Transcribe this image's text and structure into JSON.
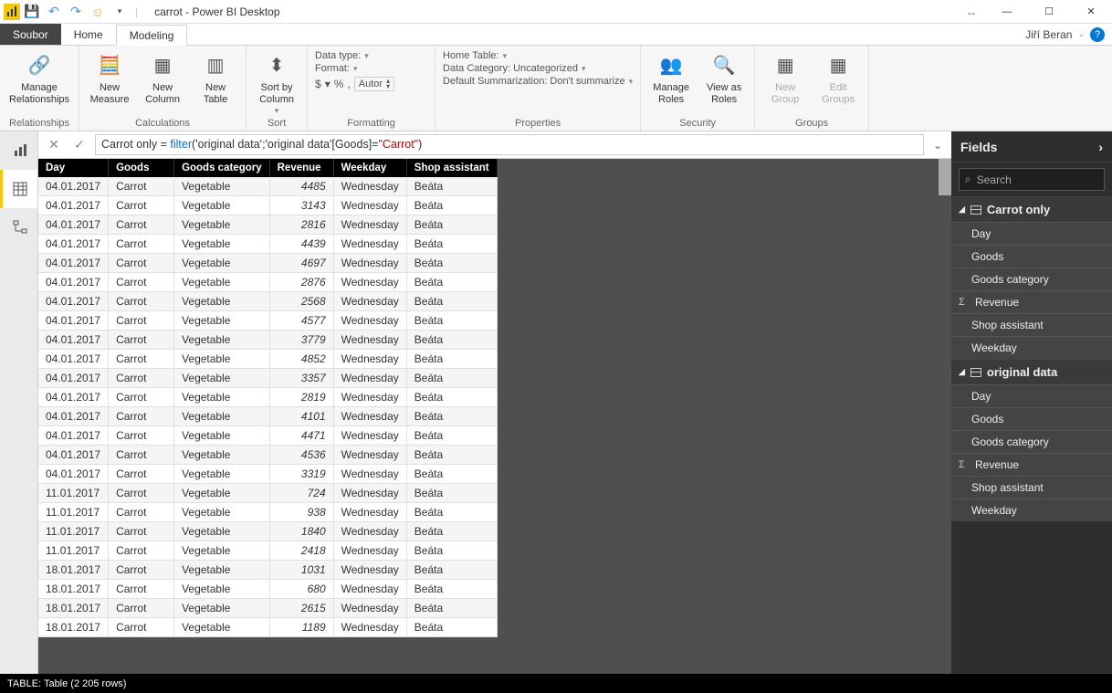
{
  "title": "carrot - Power BI Desktop",
  "user": "Jiří Beran",
  "tabs": {
    "file": "Soubor",
    "home": "Home",
    "modeling": "Modeling"
  },
  "ribbon": {
    "relationships": {
      "manage": "Manage\nRelationships",
      "group": "Relationships"
    },
    "calculations": {
      "measure": "New\nMeasure",
      "column": "New\nColumn",
      "table": "New\nTable",
      "group": "Calculations"
    },
    "sort": {
      "sortby": "Sort by\nColumn",
      "group": "Sort"
    },
    "formatting": {
      "datatype": "Data type:",
      "format": "Format:",
      "autor": "Autor",
      "group": "Formatting"
    },
    "properties": {
      "hometable": "Home Table:",
      "datacat": "Data Category: Uncategorized",
      "defsum": "Default Summarization: Don't summarize",
      "group": "Properties"
    },
    "security": {
      "manage": "Manage\nRoles",
      "viewas": "View as\nRoles",
      "group": "Security"
    },
    "groups": {
      "new": "New\nGroup",
      "edit": "Edit\nGroups",
      "group": "Groups"
    }
  },
  "formula": {
    "plain_prefix": "Carrot only = ",
    "func": "filter",
    "open": "(",
    "arg1": "'original data';'original data'[Goods]=",
    "str": "\"Carrot\"",
    "close": ")"
  },
  "columns": [
    "Day",
    "Goods",
    "Goods category",
    "Revenue",
    "Weekday",
    "Shop assistant"
  ],
  "rows": [
    [
      "04.01.2017",
      "Carrot",
      "Vegetable",
      "4485",
      "Wednesday",
      "Beáta"
    ],
    [
      "04.01.2017",
      "Carrot",
      "Vegetable",
      "3143",
      "Wednesday",
      "Beáta"
    ],
    [
      "04.01.2017",
      "Carrot",
      "Vegetable",
      "2816",
      "Wednesday",
      "Beáta"
    ],
    [
      "04.01.2017",
      "Carrot",
      "Vegetable",
      "4439",
      "Wednesday",
      "Beáta"
    ],
    [
      "04.01.2017",
      "Carrot",
      "Vegetable",
      "4697",
      "Wednesday",
      "Beáta"
    ],
    [
      "04.01.2017",
      "Carrot",
      "Vegetable",
      "2876",
      "Wednesday",
      "Beáta"
    ],
    [
      "04.01.2017",
      "Carrot",
      "Vegetable",
      "2568",
      "Wednesday",
      "Beáta"
    ],
    [
      "04.01.2017",
      "Carrot",
      "Vegetable",
      "4577",
      "Wednesday",
      "Beáta"
    ],
    [
      "04.01.2017",
      "Carrot",
      "Vegetable",
      "3779",
      "Wednesday",
      "Beáta"
    ],
    [
      "04.01.2017",
      "Carrot",
      "Vegetable",
      "4852",
      "Wednesday",
      "Beáta"
    ],
    [
      "04.01.2017",
      "Carrot",
      "Vegetable",
      "3357",
      "Wednesday",
      "Beáta"
    ],
    [
      "04.01.2017",
      "Carrot",
      "Vegetable",
      "2819",
      "Wednesday",
      "Beáta"
    ],
    [
      "04.01.2017",
      "Carrot",
      "Vegetable",
      "4101",
      "Wednesday",
      "Beáta"
    ],
    [
      "04.01.2017",
      "Carrot",
      "Vegetable",
      "4471",
      "Wednesday",
      "Beáta"
    ],
    [
      "04.01.2017",
      "Carrot",
      "Vegetable",
      "4536",
      "Wednesday",
      "Beáta"
    ],
    [
      "04.01.2017",
      "Carrot",
      "Vegetable",
      "3319",
      "Wednesday",
      "Beáta"
    ],
    [
      "11.01.2017",
      "Carrot",
      "Vegetable",
      "724",
      "Wednesday",
      "Beáta"
    ],
    [
      "11.01.2017",
      "Carrot",
      "Vegetable",
      "938",
      "Wednesday",
      "Beáta"
    ],
    [
      "11.01.2017",
      "Carrot",
      "Vegetable",
      "1840",
      "Wednesday",
      "Beáta"
    ],
    [
      "11.01.2017",
      "Carrot",
      "Vegetable",
      "2418",
      "Wednesday",
      "Beáta"
    ],
    [
      "18.01.2017",
      "Carrot",
      "Vegetable",
      "1031",
      "Wednesday",
      "Beáta"
    ],
    [
      "18.01.2017",
      "Carrot",
      "Vegetable",
      "680",
      "Wednesday",
      "Beáta"
    ],
    [
      "18.01.2017",
      "Carrot",
      "Vegetable",
      "2615",
      "Wednesday",
      "Beáta"
    ],
    [
      "18.01.2017",
      "Carrot",
      "Vegetable",
      "1189",
      "Wednesday",
      "Beáta"
    ]
  ],
  "fields": {
    "header": "Fields",
    "search": "Search",
    "tables": [
      {
        "name": "Carrot only",
        "fields": [
          {
            "n": "Day"
          },
          {
            "n": "Goods"
          },
          {
            "n": "Goods category"
          },
          {
            "n": "Revenue",
            "m": true
          },
          {
            "n": "Shop assistant"
          },
          {
            "n": "Weekday"
          }
        ]
      },
      {
        "name": "original data",
        "fields": [
          {
            "n": "Day"
          },
          {
            "n": "Goods"
          },
          {
            "n": "Goods category"
          },
          {
            "n": "Revenue",
            "m": true
          },
          {
            "n": "Shop assistant"
          },
          {
            "n": "Weekday"
          }
        ]
      }
    ]
  },
  "status": "TABLE: Table (2 205 rows)"
}
